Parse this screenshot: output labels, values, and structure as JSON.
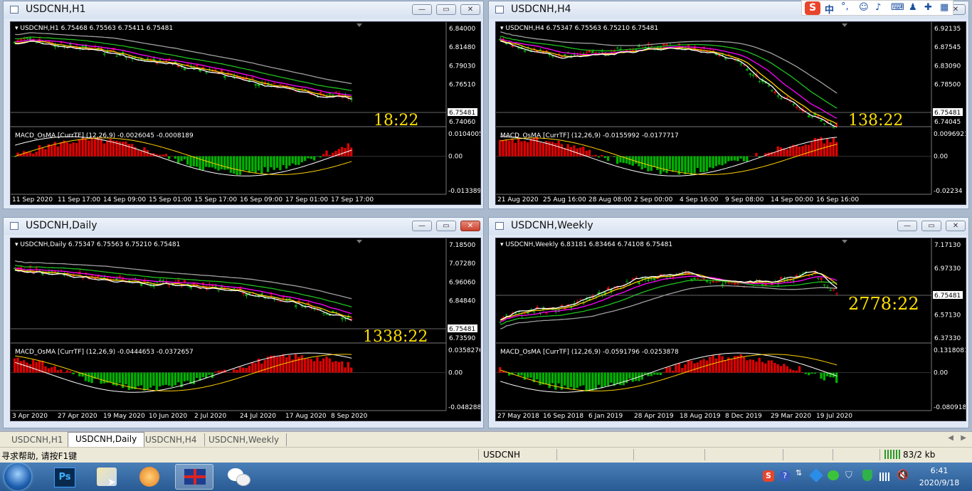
{
  "colors": {
    "bull": "#00b000",
    "bear": "#e00000",
    "ma_white": "#ffffff",
    "ma_yellow": "#ffd000",
    "ma_magenta": "#ff00ff",
    "ma_green": "#20c020",
    "ma_gray": "#a0a0a0",
    "timer": "#ffe000",
    "price_tag": "#ffffff"
  },
  "windows": [
    {
      "title": "USDCNH,H1",
      "info": "USDCNH,H1  6.75468 6.75563 6.75411 6.75481",
      "price_labels": [
        "6.84000",
        "6.81480",
        "6.79030",
        "6.76510",
        "6.75481",
        "6.74060"
      ],
      "timer": "18:22",
      "osc_info": "MACD_OsMA [CurrTF] (12,26,9) -0.0026045 -0.0008189",
      "osc_labels": [
        "0.0104005",
        "0.00",
        "-0.013389"
      ],
      "time_labels": [
        "11 Sep 2020",
        "11 Sep 17:00",
        "14 Sep 09:00",
        "15 Sep 01:00",
        "15 Sep 17:00",
        "16 Sep 09:00",
        "17 Sep 01:00",
        "17 Sep 17:00"
      ],
      "close_style": "normal"
    },
    {
      "title": "USDCNH,H4",
      "info": "USDCNH,H4  6.75347 6.75563 6.75210 6.75481",
      "price_labels": [
        "6.92135",
        "6.87545",
        "6.83090",
        "6.78500",
        "6.75481",
        "6.74045"
      ],
      "timer": "138:22",
      "osc_info": "MACD_OsMA [CurrTF] (12,26,9) -0.0155992 -0.0177717",
      "osc_labels": [
        "0.0096921",
        "0.00",
        "-0.02234"
      ],
      "time_labels": [
        "21 Aug 2020",
        "25 Aug 16:00",
        "28 Aug 08:00",
        "2 Sep 00:00",
        "4 Sep 16:00",
        "9 Sep 08:00",
        "14 Sep 00:00",
        "16 Sep 16:00"
      ],
      "close_style": "normal"
    },
    {
      "title": "USDCNH,Daily",
      "info": "USDCNH,Daily  6.75347 6.75563 6.75210 6.75481",
      "price_labels": [
        "7.18500",
        "7.07280",
        "6.96060",
        "6.84840",
        "6.75481",
        "6.73590"
      ],
      "timer": "1338:22",
      "osc_info": "MACD_OsMA [CurrTF] (12,26,9) -0.0444653 -0.0372657",
      "osc_labels": [
        "0.0358276",
        "0.00",
        "-0.048288"
      ],
      "time_labels": [
        "3 Apr 2020",
        "27 Apr 2020",
        "19 May 2020",
        "10 Jun 2020",
        "2 Jul 2020",
        "24 Jul 2020",
        "17 Aug 2020",
        "8 Sep 2020"
      ],
      "close_style": "red"
    },
    {
      "title": "USDCNH,Weekly",
      "info": "USDCNH,Weekly  6.83181 6.83464 6.74108 6.75481",
      "price_labels": [
        "7.17130",
        "6.97330",
        "6.75481",
        "6.57130",
        "6.37330"
      ],
      "timer": "2778:22",
      "osc_info": "MACD_OsMA [CurrTF] (12,26,9) -0.0591796 -0.0253878",
      "osc_labels": [
        "0.1318081",
        "0.00",
        "-0.080918"
      ],
      "time_labels": [
        "27 May 2018",
        "16 Sep 2018",
        "6 Jan 2019",
        "28 Apr 2019",
        "18 Aug 2019",
        "8 Dec 2019",
        "29 Mar 2020",
        "19 Jul 2020"
      ],
      "close_style": "normal"
    }
  ],
  "tabs": [
    "USDCNH,H1",
    "USDCNH,Daily",
    "USDCNH,H4",
    "USDCNH,Weekly"
  ],
  "active_tab": "USDCNH,Daily",
  "status": {
    "help": "寻求帮助, 请按F1键",
    "profile": "USDCNH",
    "traffic": "83/2 kb"
  },
  "ime": {
    "label": "中"
  },
  "taskbar": {
    "apps": [
      "start-orb",
      "photoshop",
      "pencil-app",
      "browser",
      "metatrader",
      "wechat"
    ],
    "ps_label": "Ps",
    "clock_time": "6:41",
    "clock_date": "2020/9/18"
  }
}
